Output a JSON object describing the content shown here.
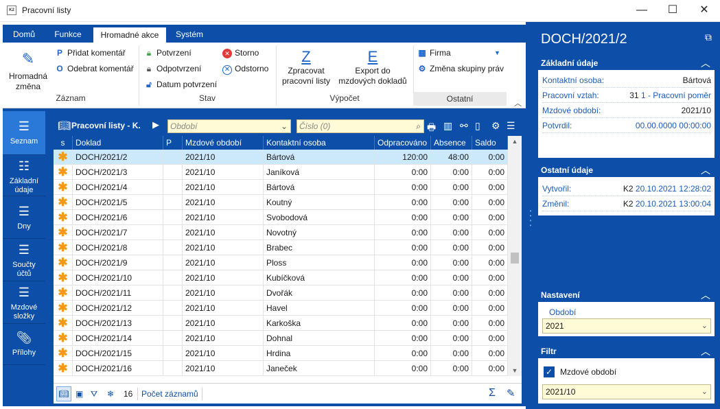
{
  "window": {
    "title": "Pracovní listy",
    "app_icon": "K2",
    "minimize_icon": "—",
    "maximize_icon": "☐",
    "close_icon": "✕"
  },
  "ribbon": {
    "tabs": [
      {
        "label": "Domů"
      },
      {
        "label": "Funkce"
      },
      {
        "label": "Hromadné akce"
      },
      {
        "label": "Systém"
      }
    ],
    "active_tab": "Hromadné akce",
    "groups": {
      "zaznam": {
        "label": "Záznam",
        "hromadna_zmena_line1": "Hromadná",
        "hromadna_zmena_line2": "změna",
        "pridat_komentar_glyph": "P",
        "pridat_komentar": "Přidat komentář",
        "odebrat_komentar_glyph": "O",
        "odebrat_komentar": "Odebrat komentář"
      },
      "stav": {
        "label": "Stav",
        "potvrzeni": "Potvrzení",
        "odpotvrzeni": "Odpotvrzení",
        "datum_potvrzeni": "Datum potvrzení",
        "storno": "Storno",
        "odstorno": "Odstorno"
      },
      "vypocet": {
        "label": "Výpočet",
        "zpracovat_glyph": "Z",
        "zpracovat_line1": "Zpracovat",
        "zpracovat_line2": "pracovní listy",
        "export_glyph": "E",
        "export_line1": "Export do",
        "export_line2": "mzdových dokladů"
      },
      "ostatni": {
        "label": "Ostatní",
        "firma": "Firma",
        "zmena_skupiny_prav": "Změna skupiny práv"
      }
    }
  },
  "vnav": {
    "items": [
      {
        "label": "Seznam",
        "label2": ""
      },
      {
        "label": "Základní",
        "label2": "údaje"
      },
      {
        "label": "Dny",
        "label2": ""
      },
      {
        "label": "Součty",
        "label2": "účtů"
      },
      {
        "label": "Mzdové",
        "label2": "složky"
      },
      {
        "label": "Přílohy",
        "label2": ""
      }
    ]
  },
  "grid": {
    "title": "Pracovní listy - K.",
    "filter_period_placeholder": "Období",
    "filter_number_placeholder": "Číslo (0)",
    "columns": [
      "s",
      "Doklad",
      "P",
      "Mzdové období",
      "Kontaktní osoba",
      "Odpracováno",
      "Absence",
      "Saldo"
    ],
    "rows": [
      {
        "doklad": "DOCH/2021/2",
        "p": "",
        "obdobi": "2021/10",
        "osoba": "Bártová",
        "odpracovano": "120:00",
        "absence": "48:00",
        "saldo": "0:00"
      },
      {
        "doklad": "DOCH/2021/3",
        "p": "",
        "obdobi": "2021/10",
        "osoba": "Janíková",
        "odpracovano": "0:00",
        "absence": "0:00",
        "saldo": "0:00"
      },
      {
        "doklad": "DOCH/2021/4",
        "p": "",
        "obdobi": "2021/10",
        "osoba": "Bártová",
        "odpracovano": "0:00",
        "absence": "0:00",
        "saldo": "0:00"
      },
      {
        "doklad": "DOCH/2021/5",
        "p": "",
        "obdobi": "2021/10",
        "osoba": "Koutný",
        "odpracovano": "0:00",
        "absence": "0:00",
        "saldo": "0:00"
      },
      {
        "doklad": "DOCH/2021/6",
        "p": "",
        "obdobi": "2021/10",
        "osoba": "Svobodová",
        "odpracovano": "0:00",
        "absence": "0:00",
        "saldo": "0:00"
      },
      {
        "doklad": "DOCH/2021/7",
        "p": "",
        "obdobi": "2021/10",
        "osoba": "Novotný",
        "odpracovano": "0:00",
        "absence": "0:00",
        "saldo": "0:00"
      },
      {
        "doklad": "DOCH/2021/8",
        "p": "",
        "obdobi": "2021/10",
        "osoba": "Brabec",
        "odpracovano": "0:00",
        "absence": "0:00",
        "saldo": "0:00"
      },
      {
        "doklad": "DOCH/2021/9",
        "p": "",
        "obdobi": "2021/10",
        "osoba": "Ploss",
        "odpracovano": "0:00",
        "absence": "0:00",
        "saldo": "0:00"
      },
      {
        "doklad": "DOCH/2021/10",
        "p": "",
        "obdobi": "2021/10",
        "osoba": "Kubíčková",
        "odpracovano": "0:00",
        "absence": "0:00",
        "saldo": "0:00"
      },
      {
        "doklad": "DOCH/2021/11",
        "p": "",
        "obdobi": "2021/10",
        "osoba": "Dvořák",
        "odpracovano": "0:00",
        "absence": "0:00",
        "saldo": "0:00"
      },
      {
        "doklad": "DOCH/2021/12",
        "p": "",
        "obdobi": "2021/10",
        "osoba": "Havel",
        "odpracovano": "0:00",
        "absence": "0:00",
        "saldo": "0:00"
      },
      {
        "doklad": "DOCH/2021/13",
        "p": "",
        "obdobi": "2021/10",
        "osoba": "Karkoška",
        "odpracovano": "0:00",
        "absence": "0:00",
        "saldo": "0:00"
      },
      {
        "doklad": "DOCH/2021/14",
        "p": "",
        "obdobi": "2021/10",
        "osoba": "Dohnal",
        "odpracovano": "0:00",
        "absence": "0:00",
        "saldo": "0:00"
      },
      {
        "doklad": "DOCH/2021/15",
        "p": "",
        "obdobi": "2021/10",
        "osoba": "Hrdina",
        "odpracovano": "0:00",
        "absence": "0:00",
        "saldo": "0:00"
      },
      {
        "doklad": "DOCH/2021/16",
        "p": "",
        "obdobi": "2021/10",
        "osoba": "Janeček",
        "odpracovano": "0:00",
        "absence": "0:00",
        "saldo": "0:00"
      }
    ],
    "selected_row": 0,
    "status": {
      "count": "16",
      "count_label": "Počet záznamů"
    }
  },
  "right_panel": {
    "title": "DOCH/2021/2",
    "zakladni_udaje": {
      "title": "Základní údaje",
      "kontaktni_osoba_label": "Kontaktní osoba:",
      "kontaktni_osoba": "Bártová",
      "pracovni_vztah_label": "Pracovní vztah:",
      "pracovni_vztah_num": "31",
      "pracovni_vztah_link": "1 - Pracovní poměr",
      "mzdove_obdobi_label": "Mzdové období:",
      "mzdove_obdobi": "2021/10",
      "potvrdil_label": "Potvrdil:",
      "potvrdil": "00.00.0000 00:00:00"
    },
    "ostatni_udaje": {
      "title": "Ostatní údaje",
      "vytvoril_label": "Vytvořil:",
      "vytvoril_user": "K2",
      "vytvoril_date": "20.10.2021 12:28:02",
      "zmenil_label": "Změnil:",
      "zmenil_user": "K2",
      "zmenil_date": "20.10.2021 13:00:04"
    },
    "nastaveni": {
      "title": "Nastavení",
      "obdobi_label": "Období",
      "obdobi_value": "2021"
    },
    "filtr": {
      "title": "Filtr",
      "mzdove_obdobi_label": "Mzdové období",
      "mzdove_obdobi_checked": true,
      "mzdove_obdobi_value": "2021/10"
    }
  },
  "colors": {
    "brand_blue": "#0d4fa8",
    "selected_row": "#cce8fb",
    "input_yellow": "#fffbd6",
    "star_orange": "#f39a1b"
  }
}
